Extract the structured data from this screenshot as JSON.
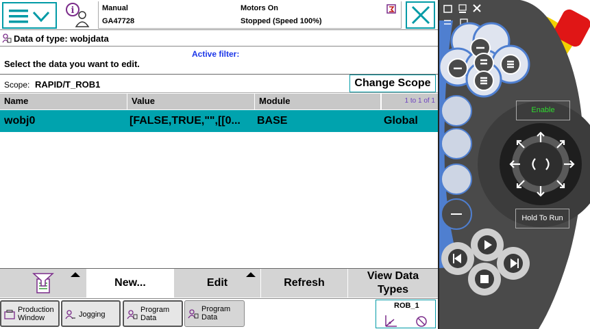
{
  "header": {
    "mode": "Manual",
    "controller": "GA47728",
    "motors": "Motors On",
    "state": "Stopped (Speed 100%)"
  },
  "title": "Data of type: wobjdata",
  "filter_label": "Active filter:",
  "instruction": "Select the data you want to edit.",
  "scope": {
    "label": "Scope:",
    "value": "RAPID/T_ROB1",
    "button": "Change Scope"
  },
  "table": {
    "columns": [
      "Name",
      "Value",
      "Module"
    ],
    "count": "1 to 1 of 1",
    "rows": [
      {
        "name": "wobj0",
        "value": "[FALSE,TRUE,\"\",[[0...",
        "module": "BASE",
        "scope": "Global"
      }
    ]
  },
  "actions": {
    "new": "New...",
    "edit": "Edit",
    "refresh": "Refresh",
    "view_types_1": "View Data",
    "view_types_2": "Types"
  },
  "taskbar": {
    "production_1": "Production",
    "production_2": "Window",
    "jogging": "Jogging",
    "program_data_1": "Program",
    "program_data_2": "Data",
    "quickset": "ROB_1"
  },
  "pendant": {
    "enable": "Enable",
    "hold_to_run": "Hold To Run"
  },
  "colors": {
    "accent": "#009aa6",
    "selection": "#00a3ae",
    "filter_text": "#1a35e8",
    "count_text": "#6a3fbf",
    "pendant_body": "#4a4a4a",
    "pendant_blue": "#4f7fd0",
    "stop_button": "#e01616",
    "yellow": "#f0d000",
    "enable_text": "#2fdc2f"
  },
  "icons": {
    "menu": "abb-menu-icon",
    "info": "event-log-icon",
    "close": "close-icon",
    "flag": "status-flag-icon",
    "filter": "filter-icon",
    "quickset": "quickset-icon"
  }
}
